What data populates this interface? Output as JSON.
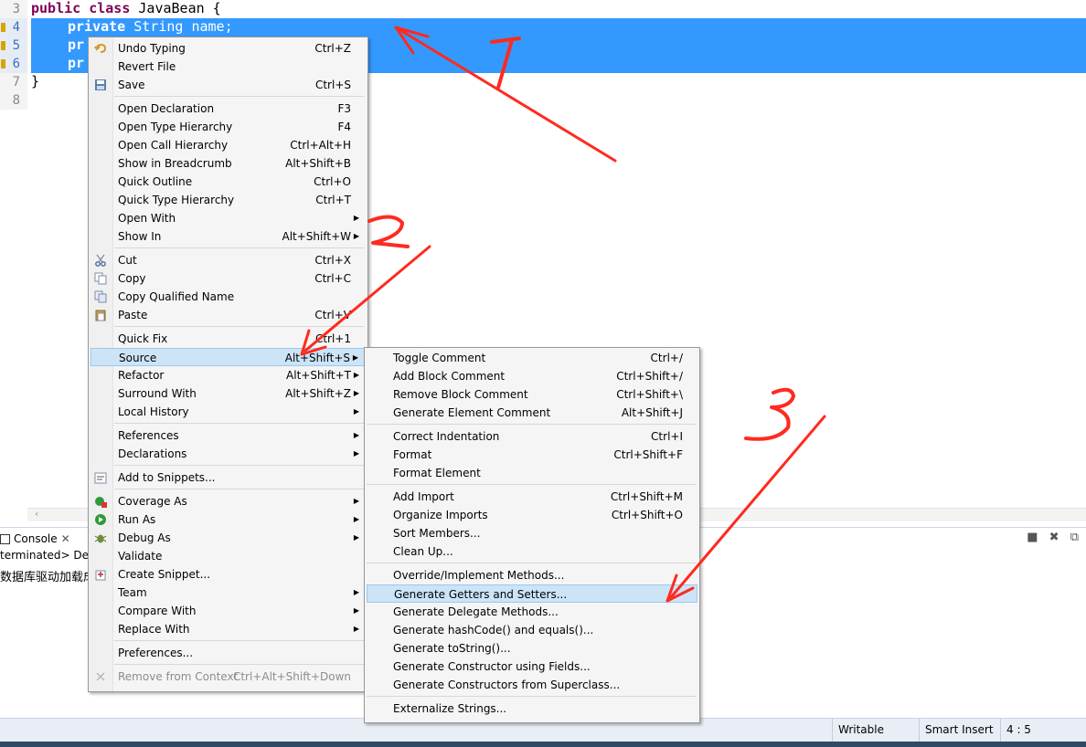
{
  "editor": {
    "lines": [
      {
        "no": "3",
        "kw": "public class",
        "rest": " JavaBean {",
        "selected": false
      },
      {
        "no": "4",
        "kw": "private",
        "rest": " String name;",
        "selected": true
      },
      {
        "no": "5",
        "kw": "pr",
        "rest": "",
        "selected": true
      },
      {
        "no": "6",
        "kw": "pr",
        "rest": "",
        "selected": true
      },
      {
        "no": "7",
        "kw": "",
        "rest": "}",
        "selected": false
      },
      {
        "no": "8",
        "kw": "",
        "rest": "",
        "selected": false
      }
    ]
  },
  "console": {
    "tab_label": "Console",
    "close_glyph": "✕",
    "status": "terminated> Dem",
    "output": "数据库驱动加载成",
    "tools": [
      "■",
      "✖",
      "⧉"
    ]
  },
  "status_bar": {
    "writable": "Writable",
    "insert_mode": "Smart Insert",
    "position": "4 : 5"
  },
  "context_menu": {
    "items": [
      {
        "label": "Undo Typing",
        "shortcut": "Ctrl+Z",
        "icon": "undo-icon"
      },
      {
        "label": "Revert File",
        "shortcut": ""
      },
      {
        "label": "Save",
        "shortcut": "Ctrl+S",
        "icon": "save-icon"
      },
      {
        "label": "Open Declaration",
        "shortcut": "F3"
      },
      {
        "label": "Open Type Hierarchy",
        "shortcut": "F4"
      },
      {
        "label": "Open Call Hierarchy",
        "shortcut": "Ctrl+Alt+H"
      },
      {
        "label": "Show in Breadcrumb",
        "shortcut": "Alt+Shift+B"
      },
      {
        "label": "Quick Outline",
        "shortcut": "Ctrl+O"
      },
      {
        "label": "Quick Type Hierarchy",
        "shortcut": "Ctrl+T"
      },
      {
        "label": "Open With",
        "shortcut": "",
        "submenu": true
      },
      {
        "label": "Show In",
        "shortcut": "Alt+Shift+W",
        "submenu": true
      },
      {
        "label": "Cut",
        "shortcut": "Ctrl+X",
        "icon": "cut-icon"
      },
      {
        "label": "Copy",
        "shortcut": "Ctrl+C",
        "icon": "copy-icon"
      },
      {
        "label": "Copy Qualified Name",
        "shortcut": "",
        "icon": "copy-qualified-icon"
      },
      {
        "label": "Paste",
        "shortcut": "Ctrl+V",
        "icon": "paste-icon"
      },
      {
        "label": "Quick Fix",
        "shortcut": "Ctrl+1"
      },
      {
        "label": "Source",
        "shortcut": "Alt+Shift+S",
        "submenu": true,
        "highlighted": true
      },
      {
        "label": "Refactor",
        "shortcut": "Alt+Shift+T",
        "submenu": true
      },
      {
        "label": "Surround With",
        "shortcut": "Alt+Shift+Z",
        "submenu": true
      },
      {
        "label": "Local History",
        "shortcut": "",
        "submenu": true
      },
      {
        "label": "References",
        "shortcut": "",
        "submenu": true
      },
      {
        "label": "Declarations",
        "shortcut": "",
        "submenu": true
      },
      {
        "label": "Add to Snippets...",
        "shortcut": "",
        "icon": "snippet-icon"
      },
      {
        "label": "Coverage As",
        "shortcut": "",
        "submenu": true,
        "icon": "coverage-icon"
      },
      {
        "label": "Run As",
        "shortcut": "",
        "submenu": true,
        "icon": "run-icon"
      },
      {
        "label": "Debug As",
        "shortcut": "",
        "submenu": true,
        "icon": "debug-icon"
      },
      {
        "label": "Validate",
        "shortcut": ""
      },
      {
        "label": "Create Snippet...",
        "shortcut": "",
        "icon": "create-snippet-icon"
      },
      {
        "label": "Team",
        "shortcut": "",
        "submenu": true
      },
      {
        "label": "Compare With",
        "shortcut": "",
        "submenu": true
      },
      {
        "label": "Replace With",
        "shortcut": "",
        "submenu": true
      },
      {
        "label": "Preferences...",
        "shortcut": ""
      },
      {
        "label": "Remove from Context",
        "shortcut": "Ctrl+Alt+Shift+Down",
        "disabled": true,
        "icon": "remove-context-icon"
      }
    ]
  },
  "source_submenu": {
    "items": [
      {
        "label": "Toggle Comment",
        "shortcut": "Ctrl+/"
      },
      {
        "label": "Add Block Comment",
        "shortcut": "Ctrl+Shift+/"
      },
      {
        "label": "Remove Block Comment",
        "shortcut": "Ctrl+Shift+\\"
      },
      {
        "label": "Generate Element Comment",
        "shortcut": "Alt+Shift+J"
      },
      {
        "label": "Correct Indentation",
        "shortcut": "Ctrl+I"
      },
      {
        "label": "Format",
        "shortcut": "Ctrl+Shift+F"
      },
      {
        "label": "Format Element",
        "shortcut": ""
      },
      {
        "label": "Add Import",
        "shortcut": "Ctrl+Shift+M"
      },
      {
        "label": "Organize Imports",
        "shortcut": "Ctrl+Shift+O"
      },
      {
        "label": "Sort Members...",
        "shortcut": ""
      },
      {
        "label": "Clean Up...",
        "shortcut": ""
      },
      {
        "label": "Override/Implement Methods...",
        "shortcut": ""
      },
      {
        "label": "Generate Getters and Setters...",
        "shortcut": "",
        "highlighted": true
      },
      {
        "label": "Generate Delegate Methods...",
        "shortcut": ""
      },
      {
        "label": "Generate hashCode() and equals()...",
        "shortcut": ""
      },
      {
        "label": "Generate toString()...",
        "shortcut": ""
      },
      {
        "label": "Generate Constructor using Fields...",
        "shortcut": ""
      },
      {
        "label": "Generate Constructors from Superclass...",
        "shortcut": ""
      },
      {
        "label": "Externalize Strings...",
        "shortcut": ""
      }
    ]
  },
  "annotations": {
    "color": "#ff2a1f",
    "marks": [
      "1",
      "2",
      "3"
    ]
  }
}
